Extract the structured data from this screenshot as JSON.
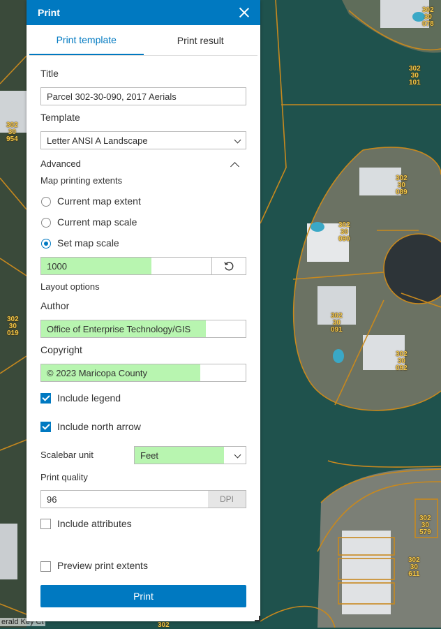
{
  "panel": {
    "title": "Print",
    "tabs": [
      {
        "label": "Print template",
        "active": true
      },
      {
        "label": "Print result",
        "active": false
      }
    ]
  },
  "form": {
    "title_label": "Title",
    "title_value": "Parcel 302-30-090, 2017 Aerials",
    "template_label": "Template",
    "template_value": "Letter ANSI A Landscape",
    "advanced_label": "Advanced",
    "extents_label": "Map printing extents",
    "extent_options": [
      {
        "label": "Current map extent",
        "checked": false
      },
      {
        "label": "Current map scale",
        "checked": false
      },
      {
        "label": "Set map scale",
        "checked": true
      }
    ],
    "scale_value": "1000",
    "layout_label": "Layout options",
    "author_label": "Author",
    "author_value": "Office of Enterprise Technology/GIS",
    "copyright_label": "Copyright",
    "copyright_value": "© 2023 Maricopa County",
    "include_legend": {
      "label": "Include legend",
      "checked": true
    },
    "include_north_arrow": {
      "label": "Include north arrow",
      "checked": true
    },
    "scalebar_label": "Scalebar unit",
    "scalebar_value": "Feet",
    "quality_label": "Print quality",
    "quality_value": "96",
    "quality_unit": "DPI",
    "include_attributes": {
      "label": "Include attributes",
      "checked": false
    },
    "preview_extents": {
      "label": "Preview print extents",
      "checked": false
    },
    "print_button": "Print"
  },
  "map": {
    "parcel_labels": [
      "302\n30\n078",
      "302\n30\n101",
      "302\n30\n954",
      "302\n30\n089",
      "302\n30\n090",
      "302\n30\n091",
      "302\n30\n092",
      "302\n30\n019",
      "302\n30\n579",
      "302\n30\n611",
      "302"
    ],
    "street_label": "erald Key Ct",
    "colors": {
      "water": "#1d4f4b",
      "parcel_line": "#c8891e",
      "label": "#f3c84b",
      "accent": "#0079c1",
      "highlight": "#b8f5b0"
    }
  }
}
